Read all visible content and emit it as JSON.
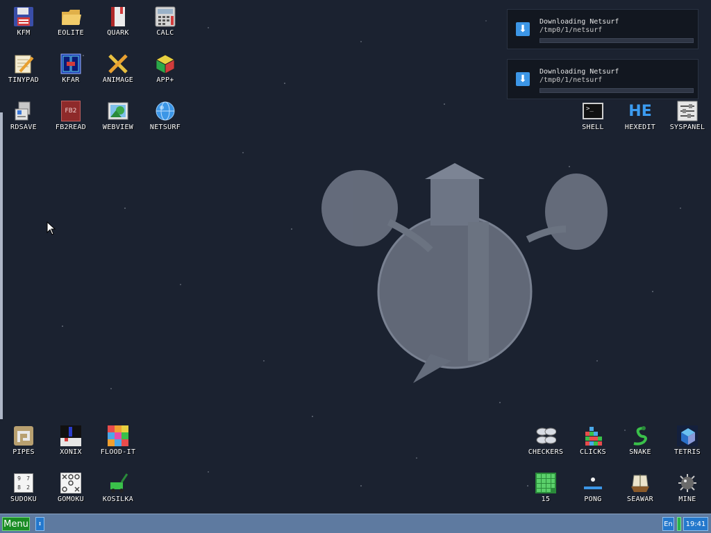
{
  "desktop": {
    "icons": {
      "kfm": "KFM",
      "eolite": "EOLITE",
      "quark": "QUARK",
      "calc": "CALC",
      "tinypad": "TINYPAD",
      "kfar": "KFAR",
      "animage": "ANIMAGE",
      "appplus": "APP+",
      "rdsave": "RDSAVE",
      "fb2read": "FB2READ",
      "webview": "WEBVIEW",
      "netsurf": "NETSURF",
      "shell": "SHELL",
      "hexedit": "HEXEDIT",
      "syspanel": "SYSPANEL",
      "pipes": "PIPES",
      "xonix": "XONIX",
      "floodit": "FLOOD-IT",
      "sudoku": "SUDOKU",
      "gomoku": "GOMOKU",
      "kosilka": "KOSILKA",
      "checkers": "CHECKERS",
      "clicks": "CLICKS",
      "snake": "SNAKE",
      "tetris": "TETRIS",
      "fifteen": "15",
      "pong": "PONG",
      "seawar": "SEAWAR",
      "mine": "MINE"
    },
    "icon_glyphs": {
      "fb2read": "FB2",
      "hexedit": "HE",
      "shell": ">_",
      "sudoku_grid": [
        "9",
        "7",
        "8",
        "2"
      ]
    }
  },
  "notifications": [
    {
      "title": "Downloading Netsurf",
      "path": "/tmp0/1/netsurf",
      "progress": 0.0
    },
    {
      "title": "Downloading Netsurf",
      "path": "/tmp0/1/netsurf",
      "progress": 0.0
    }
  ],
  "taskbar": {
    "menu_label": "Menu",
    "switch_glyph": "↕",
    "language": "En",
    "clock": "19:41"
  },
  "colors": {
    "background": "#1b2230",
    "taskbar": "#5e7aa0",
    "menu_button": "#1a8c24",
    "accent_blue": "#2478cc"
  }
}
